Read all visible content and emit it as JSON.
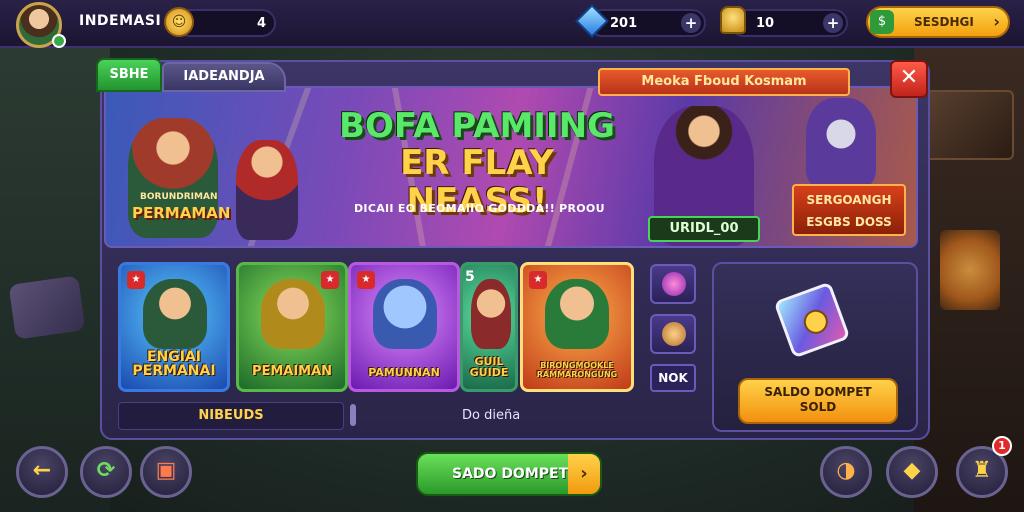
{
  "player": {
    "name": "INDEMASI",
    "coins": "4"
  },
  "currencies": {
    "gems": {
      "value": "201",
      "plus": "+"
    },
    "gold": {
      "value": "10",
      "plus": "+"
    }
  },
  "top_cta": {
    "icon": "$",
    "label": "SESDHGI",
    "arrow": "›"
  },
  "tabs": [
    {
      "label": "SBHE"
    },
    {
      "label": "IADEANDJA"
    }
  ],
  "banner": {
    "tag": "Meoka Fboud Kosmam",
    "close": "✕",
    "title_line1": "BOFA PAMIING",
    "title_line2": "ER FLAY NEASS!",
    "subtitle": "DICAII EO BEOMAIIO GODDDA!! PROOU",
    "left_small": "BORUNDRIMAN",
    "left_label": "PERMAMAN",
    "badge": "URIDL_00",
    "promo_line1": "SERGOANGH",
    "promo_line2": "ESGBS DOSS"
  },
  "games": [
    {
      "label": "ENGIAI PERMANAI"
    },
    {
      "label": "PEMAIMAN"
    },
    {
      "label": "PAMUNNAN"
    },
    {
      "label": "GUIL GUIDE",
      "corner": "5"
    },
    {
      "label": "BIRONGMOOKLE RAMMARONGUNG"
    }
  ],
  "side": {
    "text": "NOK"
  },
  "info": {
    "left": "NIBEUDS",
    "right": "Do dieña"
  },
  "wallet": {
    "line1": "SALDO DOMPET",
    "line2": "SOLD"
  },
  "bottom": {
    "back": "←",
    "main_label": "SADO DOMPET",
    "main_arrow": "›",
    "notif": "1"
  },
  "colors": {
    "accent_green": "#2a9a2a",
    "accent_orange": "#f2a10e",
    "panel": "#2a2548"
  },
  "icons": [
    "avatar",
    "coin-icon",
    "gem-icon",
    "gold-icon",
    "close-icon",
    "back-arrow-icon",
    "refresh-icon",
    "gift-chest-icon",
    "horn-icon",
    "crate-icon",
    "trophy-icon"
  ]
}
